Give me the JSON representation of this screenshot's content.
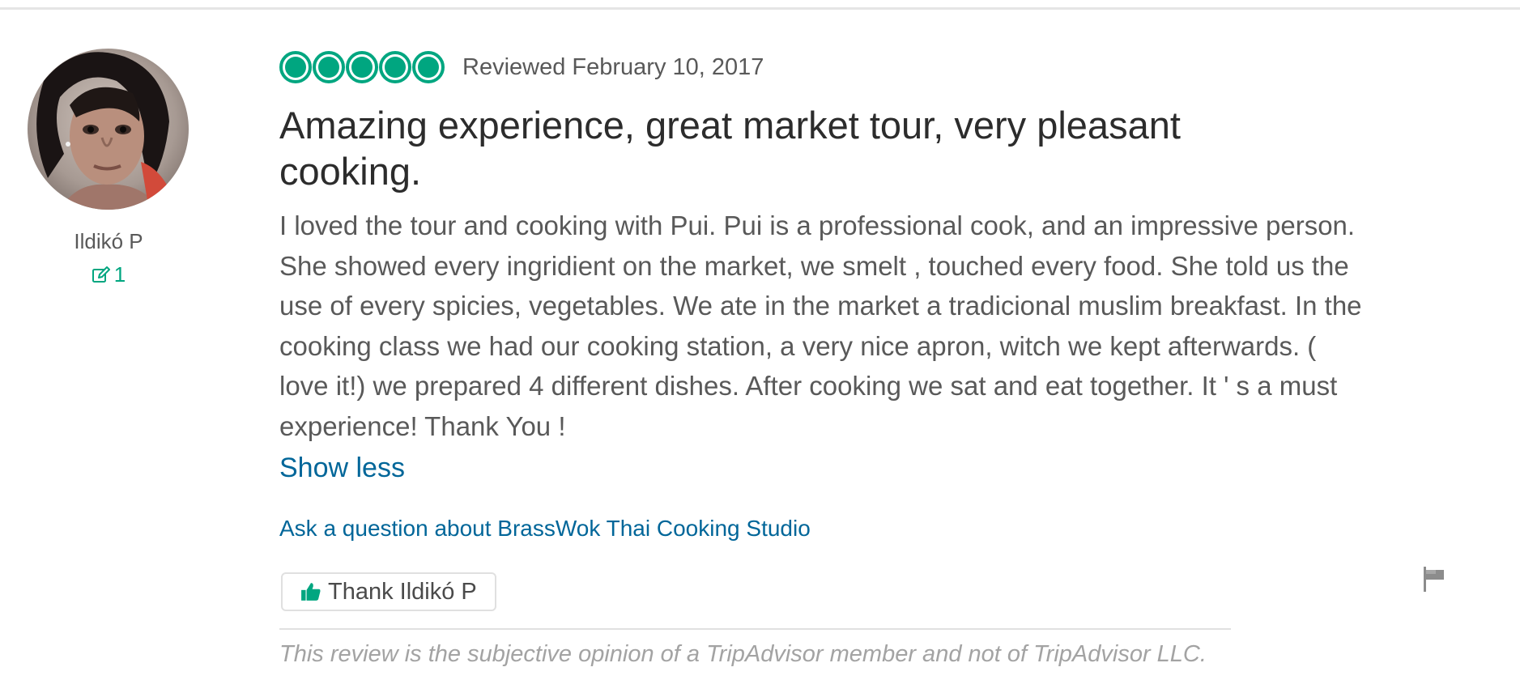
{
  "member": {
    "name": "Ildikó P",
    "contributions": "1",
    "avatar_icon": "member-photo",
    "contributions_icon": "pencil-edit-icon"
  },
  "review": {
    "rating": 5,
    "rating_max": 5,
    "date": "Reviewed February 10, 2017",
    "title": "Amazing experience, great market tour, very pleasant cooking.",
    "body": "I loved the tour and cooking with Pui. Pui is a professional cook, and an impressive person. She showed every ingridient on the market, we smelt , touched every food. She told us the use of every spicies, vegetables. We ate in the market a tradicional muslim breakfast. In the cooking class we had our cooking station, a very nice apron, witch we kept afterwards. ( love it!) we prepared 4 different dishes. After cooking we sat and eat together. It ' s a must experience! Thank You !",
    "show_less": "Show less",
    "ask_question": "Ask a question about BrassWok Thai Cooking Studio",
    "thank_button": "Thank Ildikó P",
    "disclaimer": "This review is the subjective opinion of a TripAdvisor member and not of TripAdvisor LLC."
  },
  "colors": {
    "brand_green": "#00a680",
    "link_blue": "#006699",
    "text_gray": "#595959",
    "disclaimer_gray": "#a3a3a3"
  },
  "icons": {
    "rating": "rating-bubble-icon",
    "thank": "thumbs-up-icon",
    "report": "flag-icon"
  }
}
